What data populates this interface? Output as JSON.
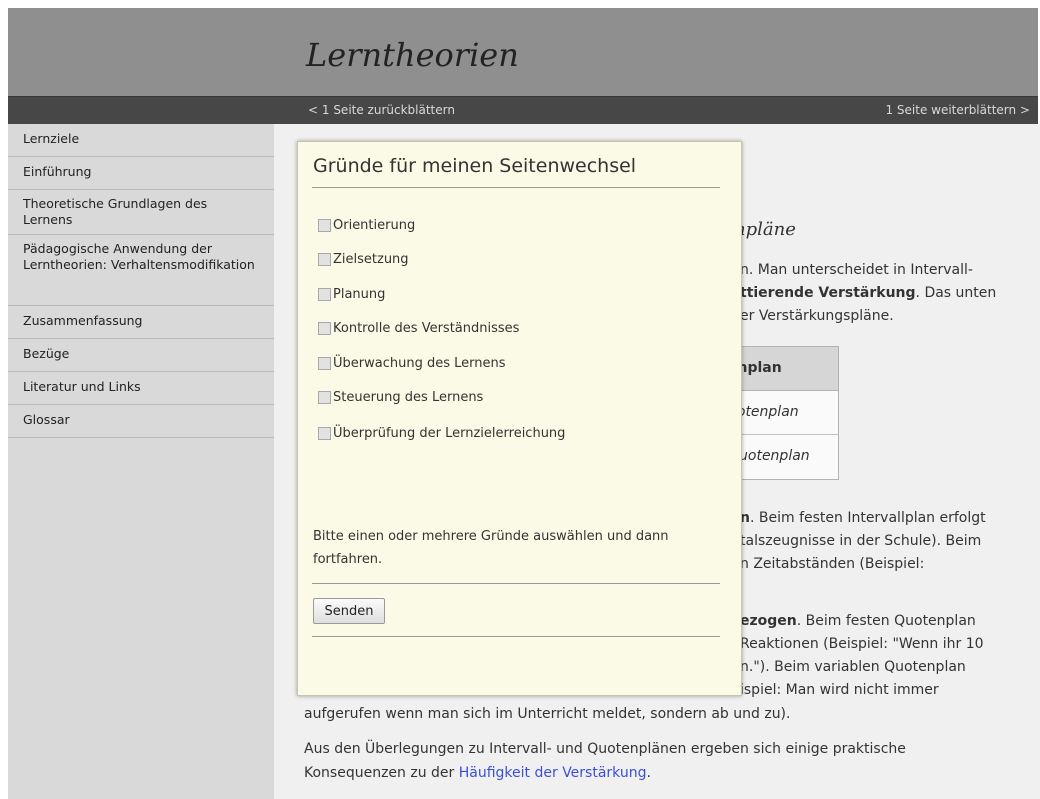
{
  "header": {
    "title": "Lerntheorien"
  },
  "navbar": {
    "prev": "< 1 Seite zurückblättern",
    "next": "1 Seite weiterblättern >"
  },
  "sidebar": {
    "items": [
      {
        "label": "Lernziele"
      },
      {
        "label": "Einführung"
      },
      {
        "label": "Theoretische Grundlagen des Lernens"
      },
      {
        "label": "Pädagogische Anwendung der Lerntheorien: Verhaltensmodifikation"
      },
      {
        "label": "Zusammenfassung"
      },
      {
        "label": "Bezüge"
      },
      {
        "label": "Literatur und Links"
      },
      {
        "label": "Glossar"
      }
    ]
  },
  "content": {
    "subhead": "npläne",
    "lines1": [
      "n. Man unterscheidet in Intervall-",
      "ttierende Verstärkung",
      ". Das unten",
      "er Verstärkungspläne."
    ],
    "table": {
      "header": "enplan",
      "rows": [
        "uotenplan",
        "Quotenplan"
      ]
    },
    "lines2": [
      "n",
      ". Beim festen Intervallplan erfolgt",
      "talszeugnisse in der Schule). Beim",
      "n Zeitabständen (Beispiel:"
    ],
    "lines3": [
      "ezogen",
      ". Beim festen Quotenplan",
      " Reaktionen (Beispiel: \"Wenn ihr 10",
      "n.\"). Beim variablen Quotenplan",
      "ispiel: Man wird nicht immer",
      "aufgerufen wenn man sich im Unterricht meldet, sondern ab und zu)."
    ],
    "final": {
      "line1": "Aus den Überlegungen zu Intervall- und Quotenplänen ergeben sich einige praktische",
      "line2_pre": "Konsequenzen zu der ",
      "link": "Häufigkeit der Verstärkung",
      "line2_post": "."
    }
  },
  "modal": {
    "title": "Gründe für meinen Seitenwechsel",
    "options": [
      {
        "label": "Orientierung",
        "checked": false
      },
      {
        "label": "Zielsetzung",
        "checked": false
      },
      {
        "label": "Planung",
        "checked": false
      },
      {
        "label": "Kontrolle des Verständnisses",
        "checked": false
      },
      {
        "label": "Überwachung des Lernens",
        "checked": false
      },
      {
        "label": "Steuerung des Lernens",
        "checked": false
      },
      {
        "label": "Überprüfung der Lernzielerreichung",
        "checked": false
      }
    ],
    "hint": "Bitte einen oder mehrere Gründe auswählen und dann fortfahren.",
    "submit": "Senden"
  }
}
